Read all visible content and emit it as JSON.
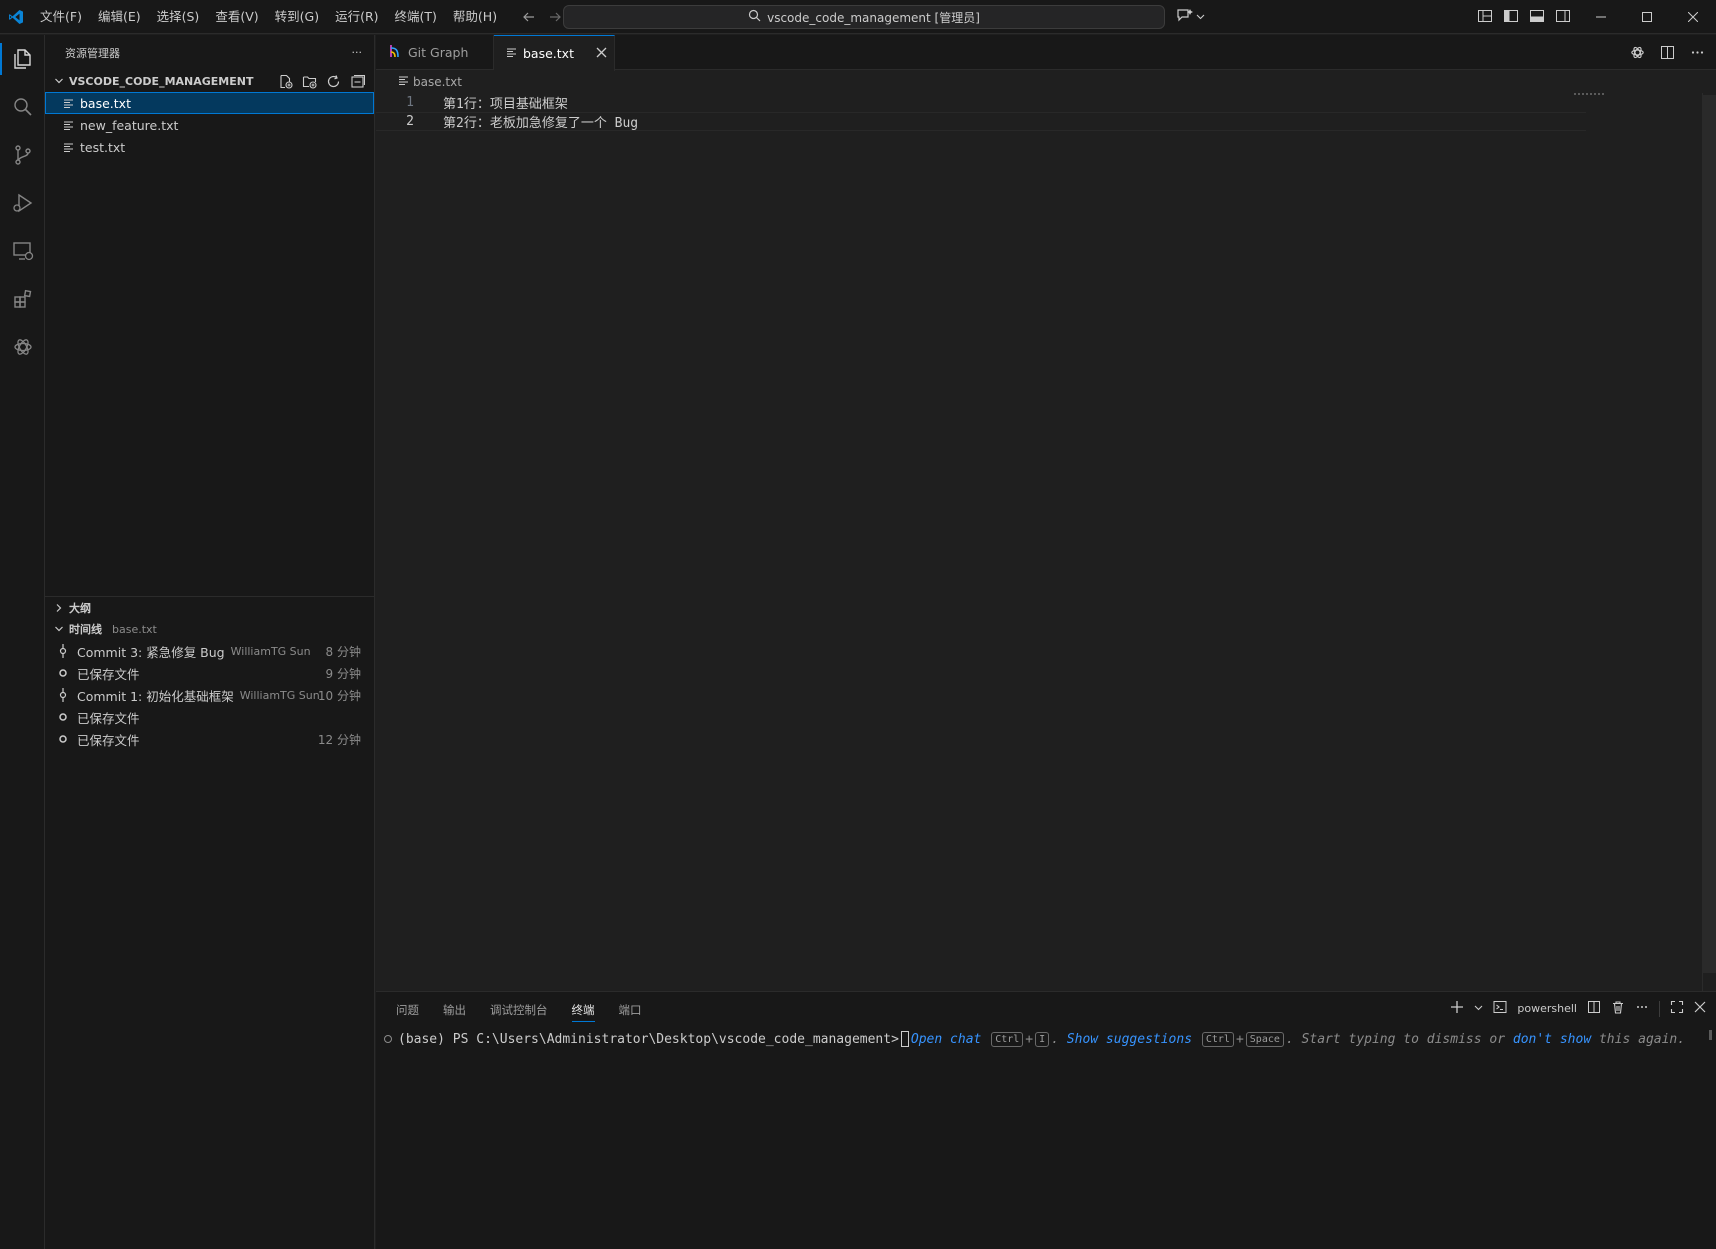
{
  "titlebar": {
    "menu": [
      "文件(F)",
      "编辑(E)",
      "选择(S)",
      "查看(V)",
      "转到(G)",
      "运行(R)",
      "终端(T)",
      "帮助(H)"
    ],
    "command_center": "vscode_code_management [管理员]"
  },
  "colors": {
    "accent": "#0078d4",
    "selection": "#04395e",
    "link": "#3794ff"
  },
  "activity": [
    "explorer-icon",
    "search-icon",
    "source-control-icon",
    "run-debug-icon",
    "remote-explorer-icon",
    "extensions-icon",
    "chatgpt-icon"
  ],
  "sidebar": {
    "title": "资源管理器",
    "more": "···",
    "folder": "VSCODE_CODE_MANAGEMENT",
    "files": [
      {
        "name": "base.txt",
        "selected": true
      },
      {
        "name": "new_feature.txt",
        "selected": false
      },
      {
        "name": "test.txt",
        "selected": false
      }
    ],
    "outline_title": "大纲",
    "timeline_title": "时间线",
    "timeline_file": "base.txt",
    "timeline": [
      {
        "icon": "commit-icon",
        "label": "Commit 3: 紧急修复 Bug",
        "author": "WilliamTG Sun",
        "time": "8 分钟"
      },
      {
        "icon": "saved-circle-icon",
        "label": "已保存文件",
        "author": "",
        "time": "9 分钟"
      },
      {
        "icon": "commit-icon",
        "label": "Commit 1: 初始化基础框架",
        "author": "WilliamTG Sun",
        "time": "10 分钟"
      },
      {
        "icon": "saved-circle-icon",
        "label": "已保存文件",
        "author": "",
        "time": ""
      },
      {
        "icon": "saved-circle-icon",
        "label": "已保存文件",
        "author": "",
        "time": "12 分钟"
      }
    ]
  },
  "editor": {
    "tabs": [
      {
        "label": "Git Graph",
        "active": false
      },
      {
        "label": "base.txt",
        "active": true
      }
    ],
    "breadcrumb": "base.txt",
    "lines": [
      {
        "num": "1",
        "text": "第1行：项目基础框架"
      },
      {
        "num": "2",
        "text": "第2行：老板加急修复了一个 Bug"
      }
    ]
  },
  "panel": {
    "tabs": [
      "问题",
      "输出",
      "调试控制台",
      "终端",
      "端口"
    ],
    "active_tab": "终端",
    "shell": "powershell",
    "prompt": "(base) PS C:\\Users\\Administrator\\Desktop\\vscode_code_management>",
    "hint": {
      "open_chat": "Open chat",
      "key_ctrl": "Ctrl",
      "plus": "+",
      "key_i": "I",
      "dot": ".",
      "show_suggestions": "Show suggestions",
      "key_space": "Space",
      "dismiss": ". Start typing to dismiss or",
      "dont_show": "don't show",
      "again": "this again."
    }
  }
}
